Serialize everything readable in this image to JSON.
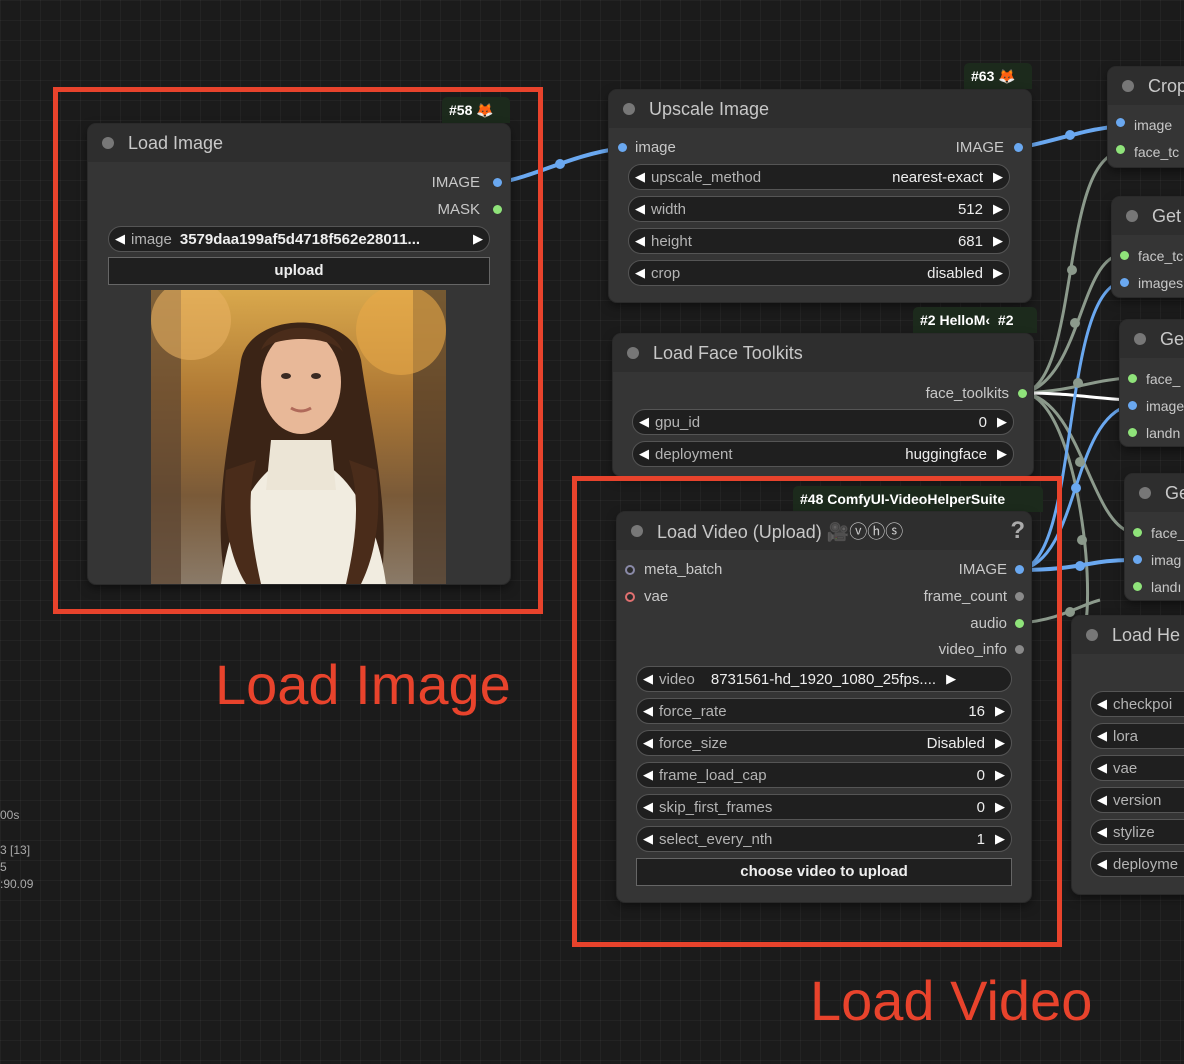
{
  "load_image": {
    "badge": "#58 🦊",
    "title": "Load Image",
    "outputs": [
      "IMAGE",
      "MASK"
    ],
    "widget": {
      "label": "image",
      "value": "3579daa199af5d4718f562e28011..."
    },
    "upload_label": "upload",
    "preview_description_colors": {
      "bg_top": "#c79a4a",
      "bg_bottom": "#8a6a3a"
    }
  },
  "upscale": {
    "badge": "#63 🦊",
    "title": "Upscale Image",
    "input": "image",
    "output": "IMAGE",
    "widgets": [
      {
        "label": "upscale_method",
        "value": "nearest-exact"
      },
      {
        "label": "width",
        "value": "512"
      },
      {
        "label": "height",
        "value": "681"
      },
      {
        "label": "crop",
        "value": "disabled"
      }
    ]
  },
  "face_toolkits": {
    "badge": "#2 HelloM‹",
    "badge2": "#2",
    "title": "Load Face Toolkits",
    "output": "face_toolkits",
    "widgets": [
      {
        "label": "gpu_id",
        "value": "0"
      },
      {
        "label": "deployment",
        "value": "huggingface"
      }
    ]
  },
  "load_video": {
    "badge": "#48 ComfyUI-VideoHelperSuite",
    "title": "Load Video (Upload) 🎥ⓥⓗⓢ",
    "help": "?",
    "inputs": [
      "meta_batch",
      "vae"
    ],
    "outputs": [
      "IMAGE",
      "frame_count",
      "audio",
      "video_info"
    ],
    "widgets": [
      {
        "label": "video",
        "value": "8731561-hd_1920_1080_25fps...."
      },
      {
        "label": "force_rate",
        "value": "16"
      },
      {
        "label": "force_size",
        "value": "Disabled"
      },
      {
        "label": "frame_load_cap",
        "value": "0"
      },
      {
        "label": "skip_first_frames",
        "value": "0"
      },
      {
        "label": "select_every_nth",
        "value": "1"
      }
    ],
    "upload_label": "choose video to upload"
  },
  "right_nodes": {
    "crop": {
      "title": "Crop",
      "inputs": [
        "image",
        "face_tc"
      ]
    },
    "get1": {
      "title": "Get",
      "inputs": [
        "face_tc",
        "images"
      ]
    },
    "get2": {
      "title": "Ge",
      "inputs": [
        "face_",
        "image",
        "landn"
      ]
    },
    "get3": {
      "title": "Ge",
      "inputs": [
        "face_",
        "imag",
        "landı"
      ]
    },
    "hello": {
      "title": "Load He",
      "widgets": [
        "checkpoi",
        "lora",
        "vae",
        "version",
        "stylize",
        "deployme"
      ]
    }
  },
  "stats": [
    "00s",
    "3 [13]",
    "5",
    ":90.09"
  ],
  "annotations": {
    "load_image": "Load Image",
    "load_video": "Load Video"
  }
}
